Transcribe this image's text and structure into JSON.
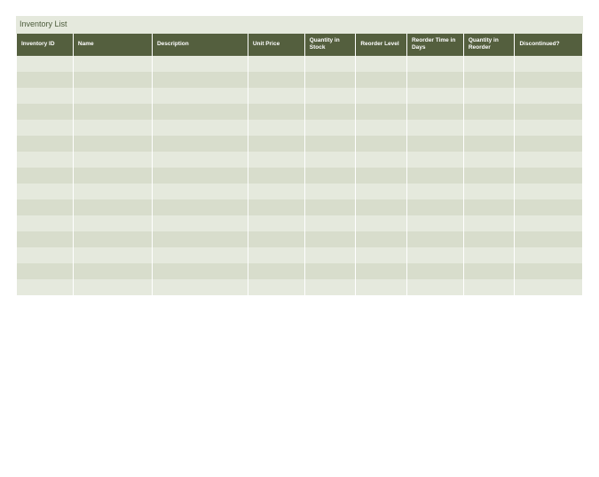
{
  "title": "Inventory List",
  "columns": [
    "Inventory ID",
    "Name",
    "Description",
    "Unit Price",
    "Quantity in Stock",
    "Reorder Level",
    "Reorder Time in Days",
    "Quantity in Reorder",
    "Discontinued?"
  ],
  "rows": [
    [
      "",
      "",
      "",
      "",
      "",
      "",
      "",
      "",
      ""
    ],
    [
      "",
      "",
      "",
      "",
      "",
      "",
      "",
      "",
      ""
    ],
    [
      "",
      "",
      "",
      "",
      "",
      "",
      "",
      "",
      ""
    ],
    [
      "",
      "",
      "",
      "",
      "",
      "",
      "",
      "",
      ""
    ],
    [
      "",
      "",
      "",
      "",
      "",
      "",
      "",
      "",
      ""
    ],
    [
      "",
      "",
      "",
      "",
      "",
      "",
      "",
      "",
      ""
    ],
    [
      "",
      "",
      "",
      "",
      "",
      "",
      "",
      "",
      ""
    ],
    [
      "",
      "",
      "",
      "",
      "",
      "",
      "",
      "",
      ""
    ],
    [
      "",
      "",
      "",
      "",
      "",
      "",
      "",
      "",
      ""
    ],
    [
      "",
      "",
      "",
      "",
      "",
      "",
      "",
      "",
      ""
    ],
    [
      "",
      "",
      "",
      "",
      "",
      "",
      "",
      "",
      ""
    ],
    [
      "",
      "",
      "",
      "",
      "",
      "",
      "",
      "",
      ""
    ],
    [
      "",
      "",
      "",
      "",
      "",
      "",
      "",
      "",
      ""
    ],
    [
      "",
      "",
      "",
      "",
      "",
      "",
      "",
      "",
      ""
    ],
    [
      "",
      "",
      "",
      "",
      "",
      "",
      "",
      "",
      ""
    ]
  ]
}
